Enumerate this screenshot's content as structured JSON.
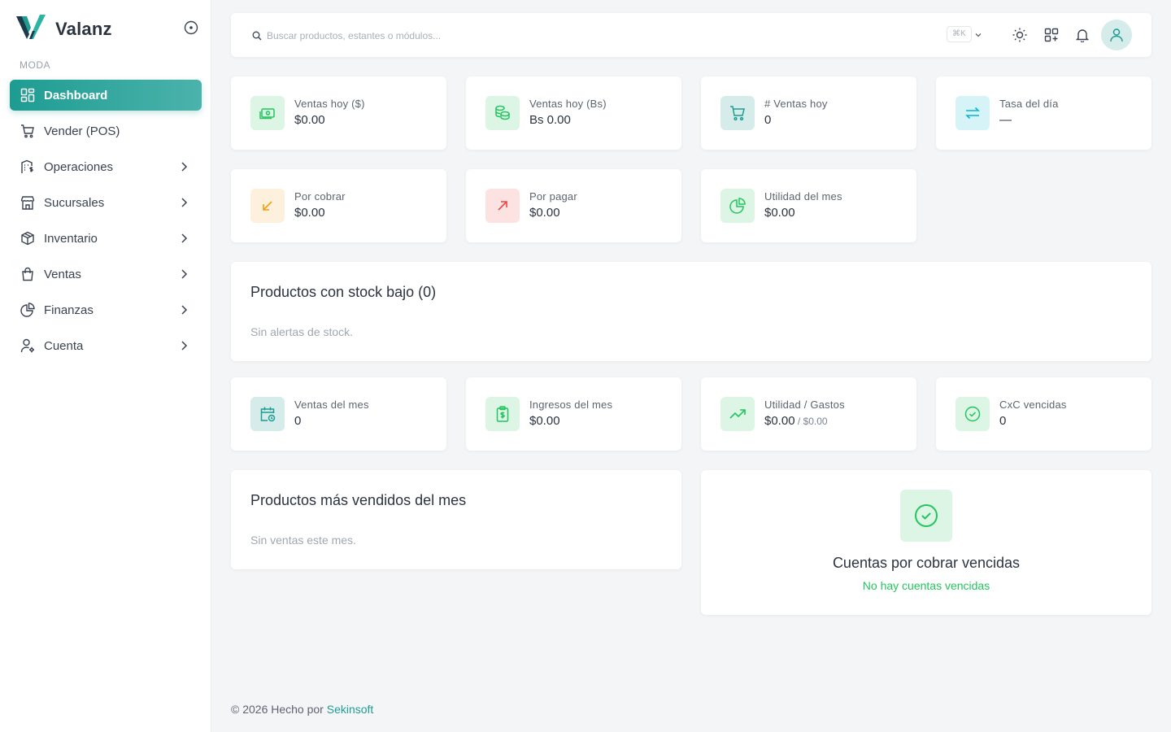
{
  "brand": {
    "name": "Valanz"
  },
  "sidebar": {
    "section": "MODA",
    "items": [
      {
        "label": "Dashboard",
        "icon": "grid-icon"
      },
      {
        "label": "Vender (POS)",
        "icon": "cart-icon"
      },
      {
        "label": "Operaciones",
        "icon": "building-dollar-icon"
      },
      {
        "label": "Sucursales",
        "icon": "store-icon"
      },
      {
        "label": "Inventario",
        "icon": "box-icon"
      },
      {
        "label": "Ventas",
        "icon": "shopping-bag-icon"
      },
      {
        "label": "Finanzas",
        "icon": "pie-chart-icon"
      },
      {
        "label": "Cuenta",
        "icon": "user-settings-icon"
      }
    ]
  },
  "topbar": {
    "search_placeholder": "Buscar productos, estantes o módulos...",
    "shortcut": "⌘K"
  },
  "stats_top": [
    {
      "label": "Ventas hoy ($)",
      "value": "$0.00"
    },
    {
      "label": "Ventas hoy (Bs)",
      "value": "Bs 0.00"
    },
    {
      "label": "# Ventas hoy",
      "value": "0"
    },
    {
      "label": "Tasa del día",
      "value": "—"
    }
  ],
  "stats_mid": [
    {
      "label": "Por cobrar",
      "value": "$0.00"
    },
    {
      "label": "Por pagar",
      "value": "$0.00"
    },
    {
      "label": "Utilidad del mes",
      "value": "$0.00"
    }
  ],
  "low_stock": {
    "title": "Productos con stock bajo (0)",
    "empty": "Sin alertas de stock."
  },
  "stats_month": [
    {
      "label": "Ventas del mes",
      "value": "0"
    },
    {
      "label": "Ingresos del mes",
      "value": "$0.00"
    },
    {
      "label": "Utilidad / Gastos",
      "value": "$0.00",
      "sub_sep": " / ",
      "sub": "$0.00"
    },
    {
      "label": "CxC vencidas",
      "value": "0"
    }
  ],
  "top_products": {
    "title": "Productos más vendidos del mes",
    "empty": "Sin ventas este mes."
  },
  "overdue": {
    "title": "Cuentas por cobrar vencidas",
    "subtitle": "No hay cuentas vencidas"
  },
  "footer": {
    "prefix": "© 2026 Hecho por ",
    "link": "Sekinsoft"
  },
  "colors": {
    "accent": "#1e9c92",
    "green": "#22c55e",
    "orange": "#f59e0b",
    "red": "#ef4444",
    "cyan": "#06b6d4"
  }
}
